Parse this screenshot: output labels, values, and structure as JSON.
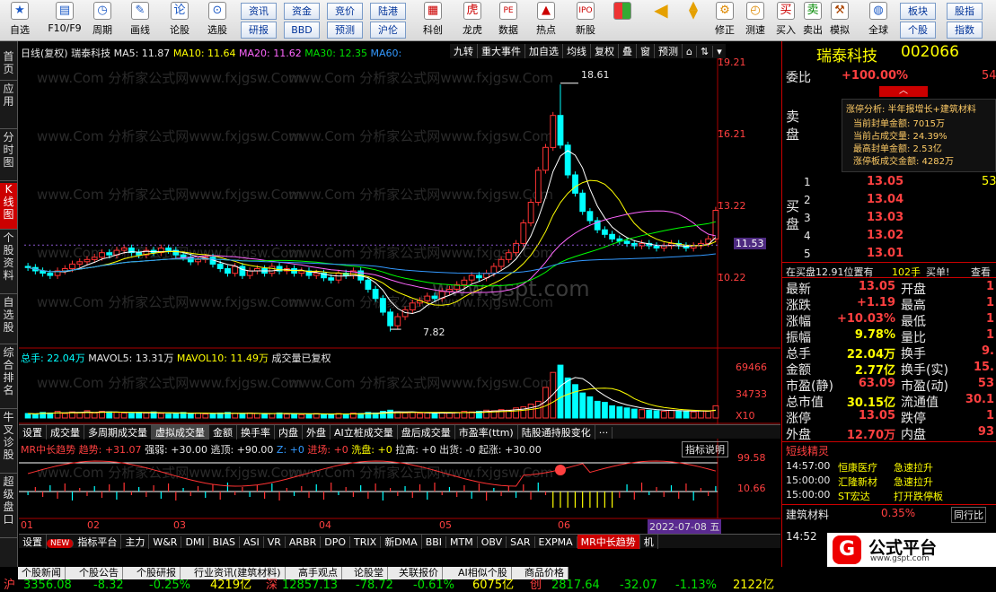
{
  "toolbar": {
    "items": [
      {
        "label": "自选",
        "icon": "star-icon"
      },
      {
        "label": "F10/F9",
        "icon": "table-icon"
      },
      {
        "label": "周期",
        "icon": "clock-icon"
      },
      {
        "label": "画线",
        "icon": "pencil-icon"
      },
      {
        "label": "论股",
        "icon": "chat-icon"
      },
      {
        "label": "选股",
        "icon": "search-icon"
      }
    ],
    "small_top": [
      "资讯",
      "资金",
      "竞价",
      "陆港"
    ],
    "small_bottom": [
      "研报",
      "BBD",
      "预测",
      "沪伦"
    ],
    "items2": [
      {
        "label": "科创",
        "icon": "chart-icon"
      },
      {
        "label": "龙虎",
        "icon": "tiger-icon"
      },
      {
        "label": "数据",
        "icon": "pe-icon"
      },
      {
        "label": "热点",
        "icon": "hot-icon"
      },
      {
        "label": "新股",
        "icon": "new-icon"
      }
    ],
    "items3": [
      {
        "label": "修正"
      },
      {
        "label": "测速"
      },
      {
        "label": "买入"
      },
      {
        "label": "卖出"
      },
      {
        "label": "模拟"
      },
      {
        "label": "全球"
      }
    ],
    "right_small": [
      "板块",
      "股指",
      "个股",
      "指数"
    ]
  },
  "leftbar": [
    "首页",
    "应用",
    "分时图",
    "K线图",
    "个股资料",
    "自选股",
    "综合排名",
    "牛叉诊股",
    "超级盘口"
  ],
  "chart": {
    "header": {
      "period": "日线(复权)",
      "name": "瑞泰科技",
      "ma5": "MA5: 11.87",
      "ma10": "MA10: 11.64",
      "ma20": "MA20: 11.62",
      "ma30": "MA30: 12.35",
      "ma60": "MA60:"
    },
    "header_buttons": [
      "九转",
      "重大事件",
      "加自选",
      "均线",
      "复权",
      "叠",
      "窗",
      "预测"
    ],
    "price_axis": [
      "19.21",
      "16.21",
      "13.22",
      "10.22"
    ],
    "current_price_tag": "11.53",
    "high_label": "18.61",
    "low_label": "7.82",
    "vol_header": {
      "total": "总手: 22.04万",
      "mavol5": "MAVOL5: 13.31万",
      "mavol10": "MAVOL10: 11.49万",
      "note": "成交量已复权"
    },
    "vol_axis": [
      "69466",
      "34733",
      "X10"
    ],
    "indicator_tabs": [
      "设置",
      "成交量",
      "多周期成交量",
      "虚拟成交量",
      "金额",
      "换手率",
      "内盘",
      "外盘",
      "AI立桩成交量",
      "盘后成交量",
      "市盈率(ttm)",
      "陆股通持股变化",
      "···"
    ],
    "indicator_header": {
      "name": "MR中长趋势",
      "trend": "趋势: +31.07",
      "strong": "强弱: +30.00",
      "escape": "逃顶: +90.00",
      "z": "Z: +0",
      "entry": "进场: +0",
      "wash": "洗盘: +0",
      "pull": "拉高: +0",
      "out": "出货: -0",
      "start": "起涨: +30.00",
      "help": "指标说明"
    },
    "ind_axis": [
      "99.58",
      "10.66"
    ],
    "months": [
      "01",
      "02",
      "03",
      "04",
      "05",
      "06"
    ],
    "date_tag": "2022-07-08 五",
    "bottom_tabs": [
      "设置",
      "NEW",
      "指标平台",
      "主力",
      "W&R",
      "DMI",
      "BIAS",
      "ASI",
      "VR",
      "ARBR",
      "DPO",
      "TRIX",
      "新DMA",
      "BBI",
      "MTM",
      "OBV",
      "SAR",
      "EXPMA",
      "MR中长趋势",
      "机"
    ],
    "watermark": "www.Com 分析家公式网www.fxjgsw.Com",
    "watermark_center": "www.gspt.com"
  },
  "candles": {
    "o": [
      10.6,
      10.55,
      10.4,
      10.3,
      10.2,
      10.4,
      10.5,
      10.7,
      10.8,
      10.9,
      11.0,
      11.2,
      11.1,
      11.3,
      11.4,
      11.2,
      11.1,
      11.3,
      11.2,
      11.4,
      11.3,
      11.1,
      11.0,
      10.8,
      10.9,
      11.0,
      10.7,
      10.5,
      10.3,
      10.6,
      10.2,
      10.4,
      10.5,
      10.3,
      10.6,
      10.4,
      10.5,
      10.3,
      10.4,
      10.2,
      10.3,
      10.1,
      10.0,
      10.3,
      10.2,
      10.4,
      10.0,
      9.6,
      9.2,
      8.6,
      8.0,
      8.4,
      8.7,
      9.0,
      9.1,
      9.3,
      9.2,
      9.5,
      9.6,
      9.8,
      10.0,
      10.2,
      10.1,
      10.3,
      10.6,
      10.9,
      11.2,
      11.6,
      12.5,
      13.4,
      14.8,
      15.8,
      17.2,
      15.9,
      14.6,
      13.8,
      13.0,
      12.6,
      12.2,
      12.0,
      11.8,
      11.7,
      11.6,
      11.5,
      11.6,
      11.5,
      11.4,
      11.5,
      11.6,
      11.5,
      11.4,
      11.5,
      11.6,
      11.8
    ],
    "c": [
      10.55,
      10.4,
      10.3,
      10.2,
      10.4,
      10.5,
      10.7,
      10.8,
      10.9,
      11.0,
      11.2,
      11.1,
      11.3,
      11.4,
      11.2,
      11.1,
      11.3,
      11.2,
      11.4,
      11.3,
      11.1,
      11.0,
      10.8,
      10.9,
      11.0,
      10.7,
      10.5,
      10.3,
      10.6,
      10.2,
      10.4,
      10.5,
      10.3,
      10.6,
      10.4,
      10.5,
      10.3,
      10.4,
      10.2,
      10.3,
      10.1,
      10.0,
      10.3,
      10.2,
      10.4,
      10.0,
      9.6,
      9.2,
      8.6,
      8.0,
      8.4,
      8.7,
      9.0,
      9.1,
      9.3,
      9.2,
      9.5,
      9.6,
      9.8,
      10.0,
      10.2,
      10.1,
      10.3,
      10.6,
      10.9,
      11.2,
      11.6,
      12.5,
      13.4,
      14.8,
      15.8,
      17.2,
      15.9,
      14.6,
      13.8,
      13.0,
      12.6,
      12.2,
      12.0,
      11.8,
      11.7,
      11.6,
      11.5,
      11.6,
      11.5,
      11.4,
      11.5,
      11.6,
      11.5,
      11.4,
      11.5,
      11.6,
      11.8,
      13.05
    ],
    "v": [
      0.08,
      0.07,
      0.1,
      0.09,
      0.12,
      0.08,
      0.11,
      0.1,
      0.13,
      0.09,
      0.12,
      0.11,
      0.1,
      0.09,
      0.08,
      0.1,
      0.09,
      0.11,
      0.08,
      0.07,
      0.09,
      0.1,
      0.08,
      0.09,
      0.07,
      0.08,
      0.09,
      0.1,
      0.08,
      0.07,
      0.09,
      0.08,
      0.07,
      0.08,
      0.09,
      0.07,
      0.08,
      0.06,
      0.07,
      0.08,
      0.07,
      0.06,
      0.08,
      0.07,
      0.09,
      0.08,
      0.1,
      0.09,
      0.12,
      0.14,
      0.11,
      0.09,
      0.1,
      0.08,
      0.09,
      0.08,
      0.1,
      0.09,
      0.1,
      0.12,
      0.11,
      0.12,
      0.14,
      0.13,
      0.15,
      0.14,
      0.18,
      0.2,
      0.25,
      0.3,
      0.55,
      0.82,
      0.95,
      0.72,
      0.6,
      0.45,
      0.38,
      0.3,
      0.28,
      0.22,
      0.2,
      0.18,
      0.16,
      0.15,
      0.14,
      0.13,
      0.12,
      0.14,
      0.13,
      0.12,
      0.11,
      0.13,
      0.12,
      0.22
    ]
  },
  "right": {
    "title": "瑞泰科技",
    "code": "002066",
    "weibi_label": "委比",
    "weibi": "+100.00%",
    "weibi_r": "54",
    "analysis": [
      "涨停分析: 半年报增长+建筑材料",
      "当前封单金额: 7015万",
      "当前占成交量: 24.39%",
      "最高封单金额: 2.53亿",
      "涨停板成交金额: 4282万"
    ],
    "sell_label": "卖盘",
    "buy_label": "买盘",
    "buys": [
      {
        "n": "1",
        "p": "13.05",
        "v": "53"
      },
      {
        "n": "2",
        "p": "13.04",
        "v": ""
      },
      {
        "n": "3",
        "p": "13.03",
        "v": ""
      },
      {
        "n": "4",
        "p": "13.02",
        "v": ""
      },
      {
        "n": "5",
        "p": "13.01",
        "v": ""
      }
    ],
    "inbuy": "在买盘12.91位置有",
    "inbuy_v": "102手",
    "inbuy_t": "买单!",
    "inbuy_look": "查看",
    "quote": [
      [
        "最新",
        "13.05",
        "开盘",
        "1"
      ],
      [
        "涨跌",
        "+1.19",
        "最高",
        "1"
      ],
      [
        "涨幅",
        "+10.03%",
        "最低",
        "1"
      ],
      [
        "振幅",
        "9.78%",
        "量比",
        "1"
      ],
      [
        "总手",
        "22.04万",
        "换手",
        "9."
      ],
      [
        "金额",
        "2.77亿",
        "换手(实)",
        "15."
      ],
      [
        "市盈(静)",
        "63.09",
        "市盈(动)",
        "53"
      ],
      [
        "总市值",
        "30.15亿",
        "流通值",
        "30.1"
      ],
      [
        "涨停",
        "13.05",
        "跌停",
        "1"
      ],
      [
        "外盘",
        "12.70万",
        "内盘",
        "93"
      ]
    ],
    "sprite_title": "短线精灵",
    "sprites": [
      {
        "t": "14:57:00",
        "n": "恒康医疗",
        "e": "急速拉升"
      },
      {
        "t": "15:00:00",
        "n": "汇隆新材",
        "e": "急速拉升"
      },
      {
        "t": "15:00:00",
        "n": "ST宏达",
        "e": "打开跌停板"
      }
    ],
    "industry": "建筑材料",
    "industry_chg": "0.35%",
    "industry_tab": "同行比",
    "time2": "14:52",
    "bottom_text": "公式平台",
    "bottom_url": "www.gspt.com"
  },
  "status": {
    "tabs": [
      "个股新闻",
      "个股公告",
      "个股研报",
      "行业资讯(建筑材料)",
      "高手观点",
      "论股堂",
      "关联报价",
      "AI相似个股",
      "商品价格"
    ],
    "sh_label": "沪",
    "sh": "3356.08",
    "sh_chg": "-8.32",
    "sh_pct": "-0.25%",
    "sh_amt": "4219亿",
    "sz_label": "深",
    "sz": "12857.13",
    "sz_chg": "-78.72",
    "sz_pct": "-0.61%",
    "sz_amt": "6075亿",
    "cy_label": "创",
    "cy": "2817.64",
    "cy_chg": "-32.07",
    "cy_pct": "-1.13%",
    "cy_amt": "2122亿"
  },
  "colors": {
    "up": "#ff3333",
    "down": "#00ffff",
    "accent": "#ffff00",
    "ma5": "#ffffff",
    "ma10": "#ffff00",
    "ma20": "#ff66ff",
    "ma30": "#00ff00",
    "ma60": "#3399ff"
  }
}
